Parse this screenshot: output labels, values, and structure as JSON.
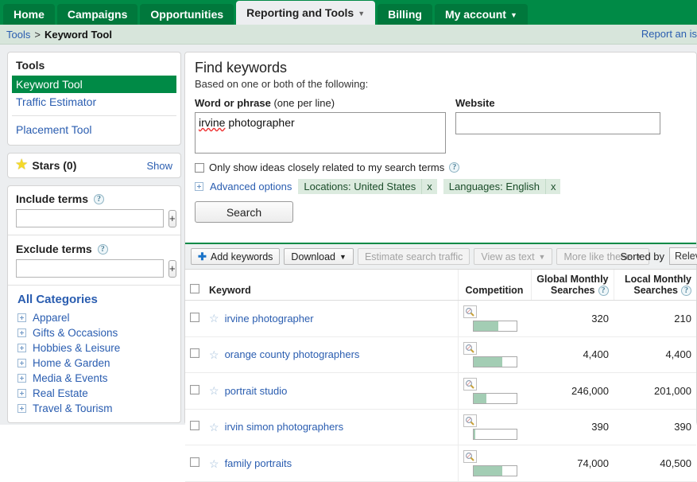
{
  "nav": {
    "tabs": [
      {
        "label": "Home",
        "active": false,
        "caret": false
      },
      {
        "label": "Campaigns",
        "active": false,
        "caret": false
      },
      {
        "label": "Opportunities",
        "active": false,
        "caret": false
      },
      {
        "label": "Reporting and Tools",
        "active": true,
        "caret": true
      },
      {
        "label": "Billing",
        "active": false,
        "caret": false
      },
      {
        "label": "My account",
        "active": false,
        "caret": true
      }
    ]
  },
  "breadcrumb": {
    "root": "Tools",
    "separator": ">",
    "current": "Keyword Tool",
    "report_link": "Report an is"
  },
  "sidebar": {
    "tools": {
      "title": "Tools",
      "items": [
        {
          "label": "Keyword Tool",
          "selected": true
        },
        {
          "label": "Traffic Estimator",
          "selected": false
        },
        {
          "label": "Placement Tool",
          "selected": false
        }
      ]
    },
    "stars": {
      "label": "Stars (0)",
      "show_label": "Show",
      "icon": "star-icon"
    },
    "include_terms": {
      "label": "Include terms",
      "value": "",
      "add_label": "+",
      "help": "?"
    },
    "exclude_terms": {
      "label": "Exclude terms",
      "value": "",
      "add_label": "+",
      "help": "?"
    },
    "categories": {
      "title": "All Categories",
      "items": [
        {
          "label": "Apparel"
        },
        {
          "label": "Gifts & Occasions"
        },
        {
          "label": "Hobbies & Leisure"
        },
        {
          "label": "Home & Garden"
        },
        {
          "label": "Media & Events"
        },
        {
          "label": "Real Estate"
        },
        {
          "label": "Travel & Tourism"
        }
      ]
    }
  },
  "find_keywords": {
    "title": "Find keywords",
    "subtitle": "Based on one or both of the following:",
    "word_label_bold": "Word or phrase",
    "word_label_norm": "(one per line)",
    "word_value_misspelled": "irvine",
    "word_value_rest": " photographer",
    "website_label": "Website",
    "website_value": "",
    "website_placeholder": "",
    "only_show_label": "Only show ideas closely related to my search terms",
    "only_show_checked": false,
    "advanced_options_label": "Advanced options",
    "chips": [
      {
        "text": "Locations: United States",
        "close": "x"
      },
      {
        "text": "Languages: English",
        "close": "x"
      }
    ],
    "search_button": "Search"
  },
  "results": {
    "toolbar": {
      "add_keywords": "Add keywords",
      "download": "Download",
      "estimate_search_traffic": "Estimate search traffic",
      "view_as_text": "View as text",
      "more_like_these": "More like these",
      "sorted_by_label": "Sorted by",
      "sorted_by_value": "Relev"
    },
    "columns": {
      "keyword": "Keyword",
      "competition": "Competition",
      "global_line1": "Global Monthly",
      "global_line2": "Searches",
      "local_line1": "Local Monthly",
      "local_line2": "Searches"
    },
    "rows": [
      {
        "keyword": "irvine photographer",
        "competition_pct": 58,
        "global": "320",
        "local": "210"
      },
      {
        "keyword": "orange county photographers",
        "competition_pct": 68,
        "global": "4,400",
        "local": "4,400"
      },
      {
        "keyword": "portrait studio",
        "competition_pct": 30,
        "global": "246,000",
        "local": "201,000"
      },
      {
        "keyword": "irvin simon photographers",
        "competition_pct": 5,
        "global": "390",
        "local": "390"
      },
      {
        "keyword": "family portraits",
        "competition_pct": 68,
        "global": "74,000",
        "local": "40,500"
      }
    ]
  },
  "colors": {
    "brand_green": "#008a46",
    "link_blue": "#2a5db0",
    "competition_fill": "#a3cdb4",
    "chip_bg": "#dcebdf"
  }
}
